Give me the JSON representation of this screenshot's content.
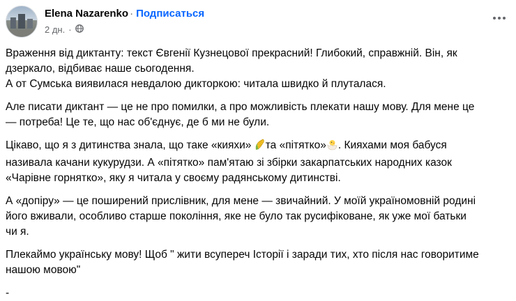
{
  "post": {
    "author": "Elena Nazarenko",
    "separator": "·",
    "follow_label": "Подписаться",
    "time": "2 дн.",
    "time_sep": "·",
    "paragraphs": {
      "p1_l1": "Враження від диктанту: текст Євгенії Кузнецової  прекрасний! Глибокий, справжній. Він, як",
      "p1_l2": "дзеркало, відбиває наше сьогодення.",
      "p1_l3": "А от Сумська виявилася невдалою дикторкою: читала швидко й плуталася.",
      "p2_l1": "Але писати диктант — це не про помилки, а про можливість плекати нашу мову. Для мене це",
      "p2_l2": "— потреба! Це те, що нас об'єднує, де б ми не були.",
      "p3_a": "Цікаво, що я з дитинства знала, що таке «кияхи» ",
      "p3_b": "та «пітятко»",
      "p3_c": ". Кияхами моя бабуся",
      "p3_l2": "називала качани кукурудзи. А «пітятко» пам'ятаю зі збірки закарпатських народних казок",
      "p3_l3": "«Чарівне горнятко», яку я читала у своєму радянському дитинстві.",
      "p4_l1": "А «допіру» — це поширений прислівник, для мене — звичайний. У моїй україномовній родині",
      "p4_l2": "його вживали, особливо старше покоління, яке не було так русифіковане, як уже мої батьки",
      "p4_l3": "чи я.",
      "p5_l1": "Плекаймо українську мову! Щоб \" жити всупереч Історії і заради тих, хто після нас говоритиме",
      "p5_l2": "нашою мовою\"",
      "p6": "-"
    }
  },
  "icons": {
    "globe": "globe-icon",
    "corn": "corn-emoji-icon",
    "chick": "hatching-chick-emoji-icon",
    "more": "more-options-icon"
  },
  "colors": {
    "accent": "#0866ff",
    "secondary_text": "#65676b",
    "text": "#050505"
  }
}
